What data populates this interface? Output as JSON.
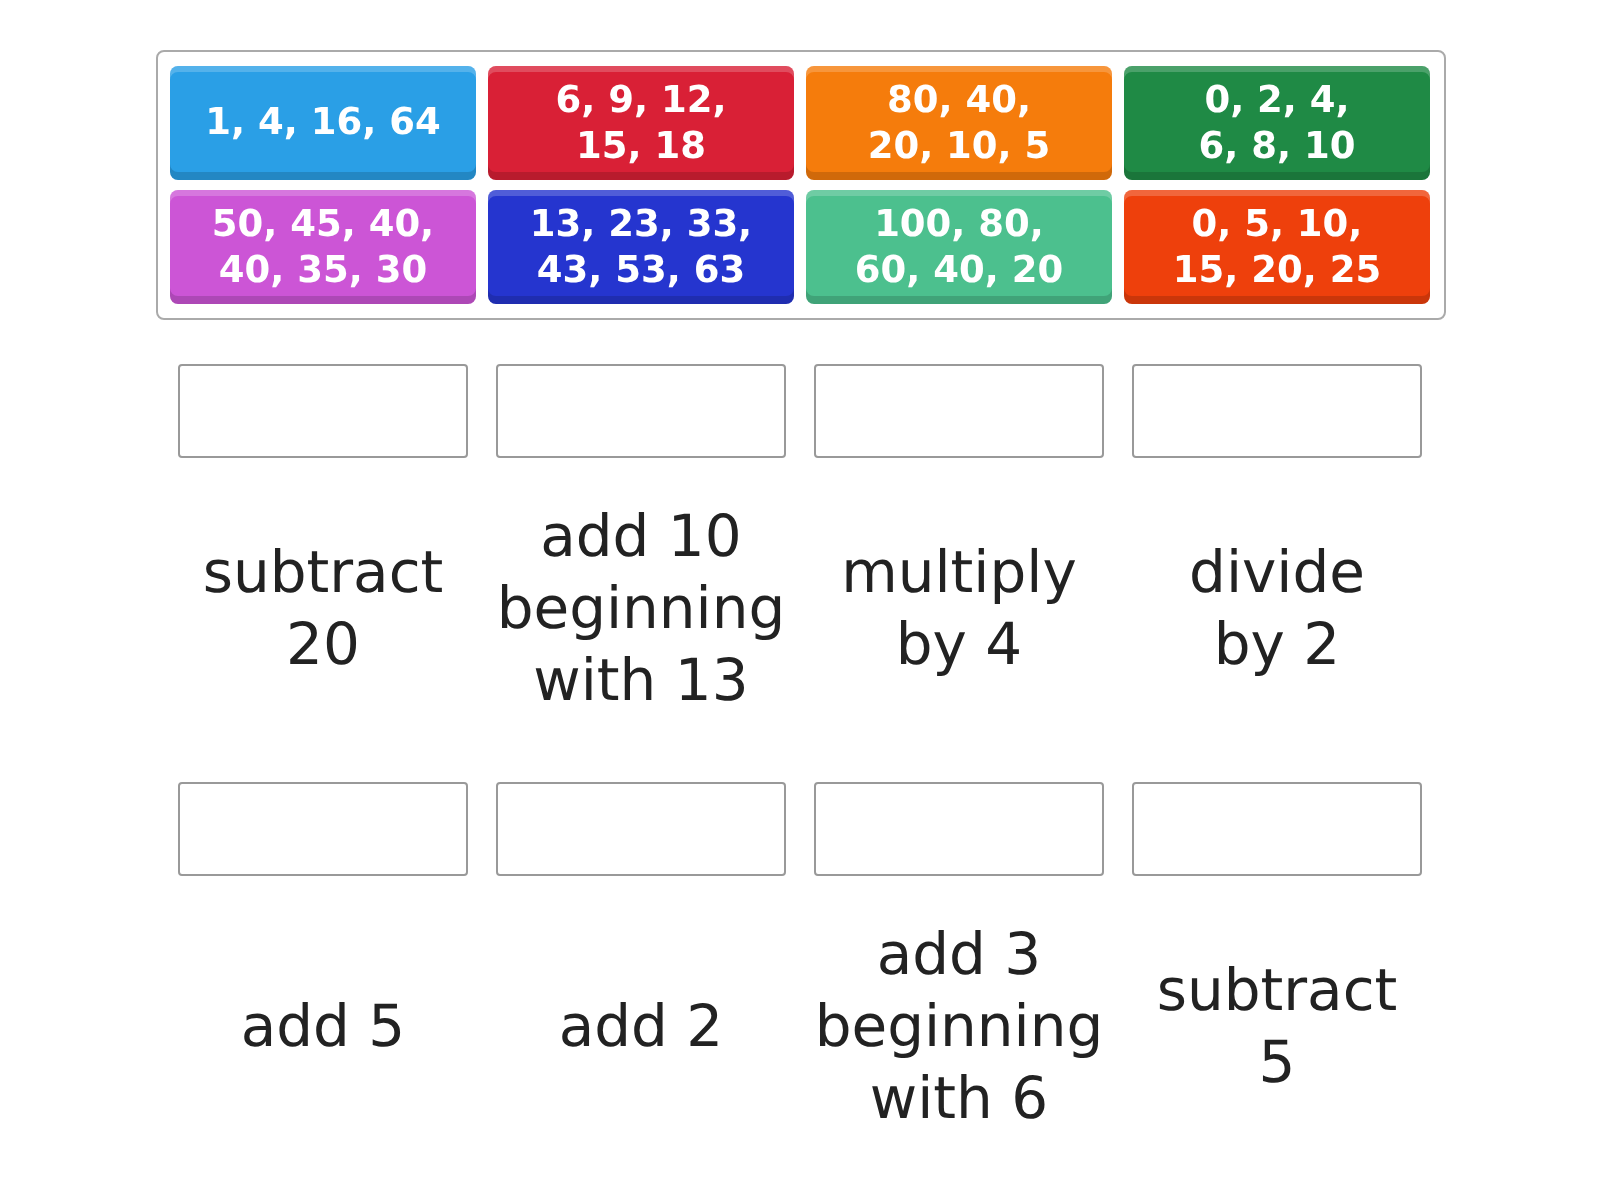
{
  "tiles": [
    {
      "text": "1, 4, 16, 64",
      "color": "#2a9fe6"
    },
    {
      "text": "6, 9, 12,\n15, 18",
      "color": "#d92036"
    },
    {
      "text": "80, 40,\n20, 10, 5",
      "color": "#f57c0c"
    },
    {
      "text": "0, 2, 4,\n6, 8, 10",
      "color": "#1f8a45"
    },
    {
      "text": "50, 45, 40,\n40, 35, 30",
      "color": "#cc55d6"
    },
    {
      "text": "13, 23, 33,\n43, 53, 63",
      "color": "#2535cf"
    },
    {
      "text": "100, 80,\n60, 40, 20",
      "color": "#4cc08e"
    },
    {
      "text": "0, 5, 10,\n15, 20, 25",
      "color": "#ee400c"
    }
  ],
  "targets": [
    {
      "label": "subtract\n20"
    },
    {
      "label": "add 10\nbeginning\nwith 13"
    },
    {
      "label": "multiply\nby 4"
    },
    {
      "label": "divide\nby 2"
    },
    {
      "label": "add 5"
    },
    {
      "label": "add 2"
    },
    {
      "label": "add 3\nbeginning\nwith 6"
    },
    {
      "label": "subtract\n5"
    }
  ]
}
